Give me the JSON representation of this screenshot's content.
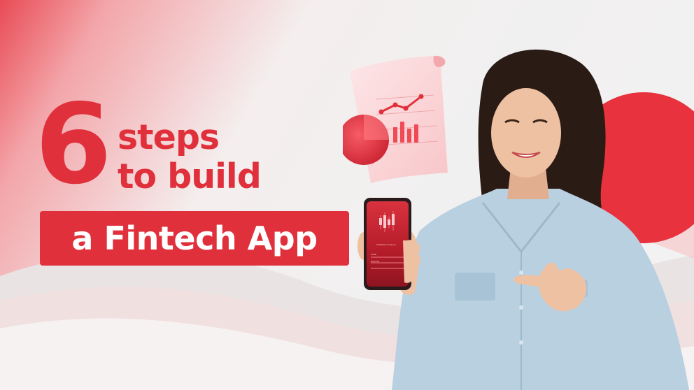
{
  "headline": {
    "number": "6",
    "line1": "steps",
    "line2": "to build",
    "highlight": "a Fintech App"
  },
  "phone": {
    "label1": "Available currency",
    "label2": "Profit",
    "label3": "Amount"
  },
  "colors": {
    "brand_red": "#e0303c",
    "background": "#f2f0f0",
    "shirt_blue": "#b9d0e0"
  }
}
